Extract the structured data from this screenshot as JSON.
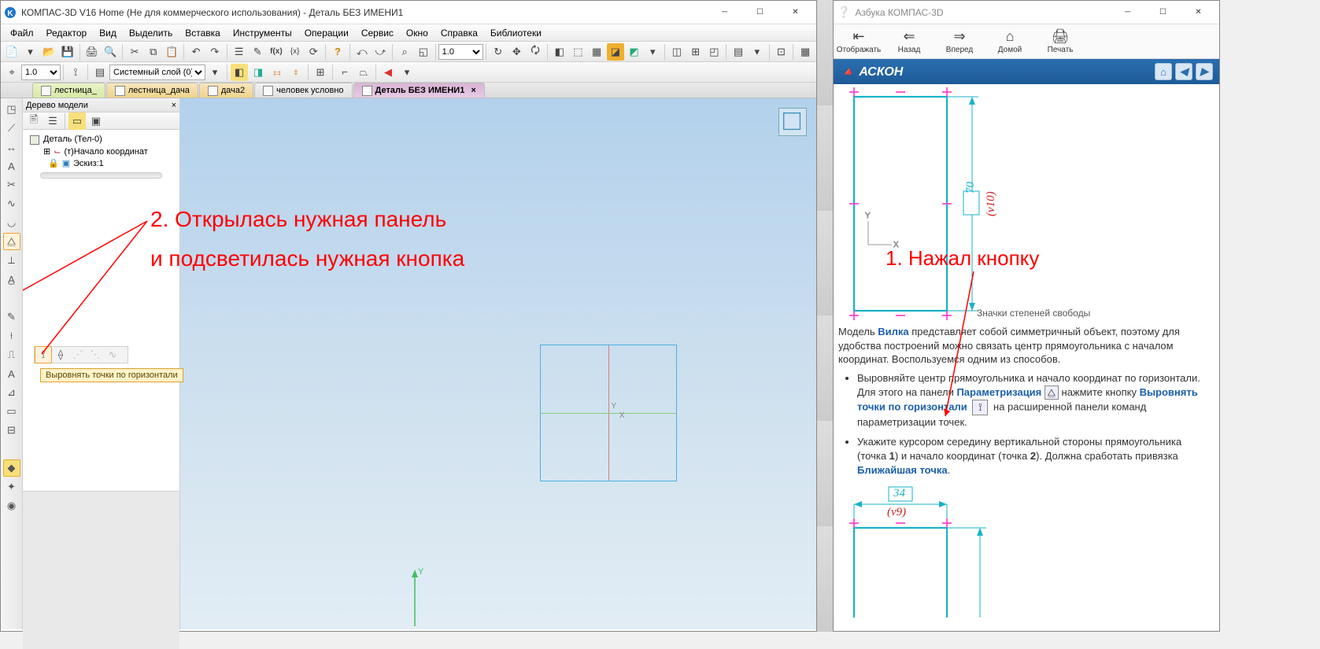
{
  "left_window": {
    "title": "КОМПАС-3D V16 Home  (Не для коммерческого использования) - Деталь БЕЗ ИМЕНИ1",
    "menu": [
      "Файл",
      "Редактор",
      "Вид",
      "Выделить",
      "Вставка",
      "Инструменты",
      "Операции",
      "Сервис",
      "Окно",
      "Справка",
      "Библиотеки"
    ],
    "toolbar_zoom1": "1.0",
    "toolbar_zoom2": "1.0",
    "layer_select": "Системный слой (0)",
    "tabs": [
      {
        "label": "лестница_",
        "kind": "docgreen"
      },
      {
        "label": "лестница_дача",
        "kind": "docorange"
      },
      {
        "label": "дача2",
        "kind": "docorange"
      },
      {
        "label": "человек условно",
        "kind": "docgray"
      },
      {
        "label": "Деталь БЕЗ ИМЕНИ1",
        "kind": "active"
      }
    ],
    "tree": {
      "title": "Дерево модели",
      "root": "Деталь (Тел-0)",
      "origin": "(т)Начало координат",
      "sketch": "Эскиз:1"
    },
    "tooltip": "Выровнять точки по горизонтали",
    "annot1": "2. Открылась нужная панель",
    "annot2": "и подсветилась нужная кнопка",
    "axis_x": "X",
    "axis_y": "Y",
    "green_axis_y": "Y"
  },
  "right_window": {
    "title": "Азбука КОМПАС-3D",
    "nav": [
      "Отображать",
      "Назад",
      "Вперед",
      "Домой",
      "Печать"
    ],
    "brand": "АСКОН",
    "annot": "1. Нажал кнопку",
    "dim_70": "70",
    "var_v10": "(v10)",
    "dim_34": "34",
    "var_v9": "(v9)",
    "caption": "Значки степеней свободы",
    "p1_pre": "Модель ",
    "p1_link": "Вилка",
    "p1_post": " представляет собой симметричный объект, поэтому для удобства построений можно связать центр прямоугольника с началом координат. Воспользуемся одним из способов.",
    "li1_pre": "Выровняйте центр прямоугольника и начало координат по горизонтали. Для этого на панели ",
    "li1_link1": "Параметризация",
    "li1_mid": " нажмите кнопку ",
    "li1_link2": "Выровнять точки по горизонтали",
    "li1_post": " на расширенной панели команд параметризации точек.",
    "li2_a": "Укажите курсором середину вертикальной стороны прямоугольника (точка ",
    "li2_b": "1",
    "li2_c": ") и начало координат (точка ",
    "li2_d": "2",
    "li2_e": "). Должна сработать привязка ",
    "li2_link": "Ближайшая точка",
    "li2_f": "."
  }
}
